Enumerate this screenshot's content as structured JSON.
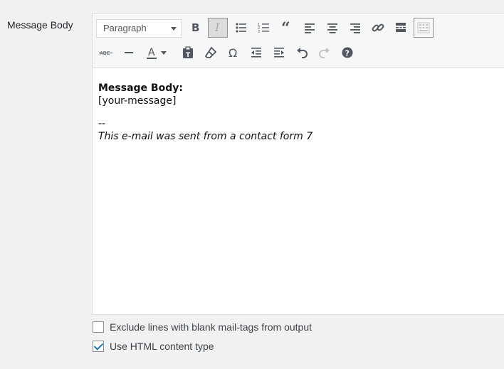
{
  "field_label": "Message Body",
  "toolbar": {
    "format_select": "Paragraph",
    "row1": [
      {
        "name": "bold-button",
        "icon": "bold-icon"
      },
      {
        "name": "italic-button",
        "icon": "italic-icon",
        "active": true
      },
      {
        "name": "bulleted-list-button",
        "icon": "bulleted-list-icon"
      },
      {
        "name": "numbered-list-button",
        "icon": "numbered-list-icon"
      },
      {
        "name": "blockquote-button",
        "icon": "blockquote-icon"
      },
      {
        "name": "align-left-button",
        "icon": "align-left-icon"
      },
      {
        "name": "align-center-button",
        "icon": "align-center-icon"
      },
      {
        "name": "align-right-button",
        "icon": "align-right-icon"
      },
      {
        "name": "insert-link-button",
        "icon": "link-icon"
      },
      {
        "name": "read-more-button",
        "icon": "read-more-icon"
      },
      {
        "name": "toolbar-toggle-button",
        "icon": "toolbar-toggle-icon",
        "active": true
      }
    ],
    "row2": [
      {
        "name": "strikethrough-button",
        "icon": "strikethrough-icon",
        "text": "ABC"
      },
      {
        "name": "horizontal-line-button",
        "icon": "horizontal-line-icon"
      },
      {
        "name": "text-color-button",
        "icon": "text-color-icon",
        "text": "A"
      },
      {
        "name": "text-color-dropdown",
        "icon": "caret-down-icon"
      },
      {
        "name": "paste-text-button",
        "icon": "paste-text-icon"
      },
      {
        "name": "clear-formatting-button",
        "icon": "eraser-icon"
      },
      {
        "name": "special-character-button",
        "icon": "omega-icon",
        "text": "Ω"
      },
      {
        "name": "decrease-indent-button",
        "icon": "outdent-icon"
      },
      {
        "name": "increase-indent-button",
        "icon": "indent-icon"
      },
      {
        "name": "undo-button",
        "icon": "undo-icon"
      },
      {
        "name": "redo-button",
        "icon": "redo-icon",
        "disabled": true
      },
      {
        "name": "help-button",
        "icon": "help-icon",
        "text": "?"
      }
    ]
  },
  "content": {
    "heading": "Message Body:",
    "tag": "[your-message]",
    "separator": "--",
    "signature": "This e-mail was sent from a contact form 7"
  },
  "options": {
    "exclude_blank_label": "Exclude lines with blank mail-tags from output",
    "exclude_blank_checked": false,
    "use_html_label": "Use HTML content type",
    "use_html_checked": true
  },
  "colors": {
    "background": "#f1f1f1",
    "toolbar": "#f6f7f7",
    "icon": "#50575e",
    "checkbox_accent": "#2271b1"
  }
}
